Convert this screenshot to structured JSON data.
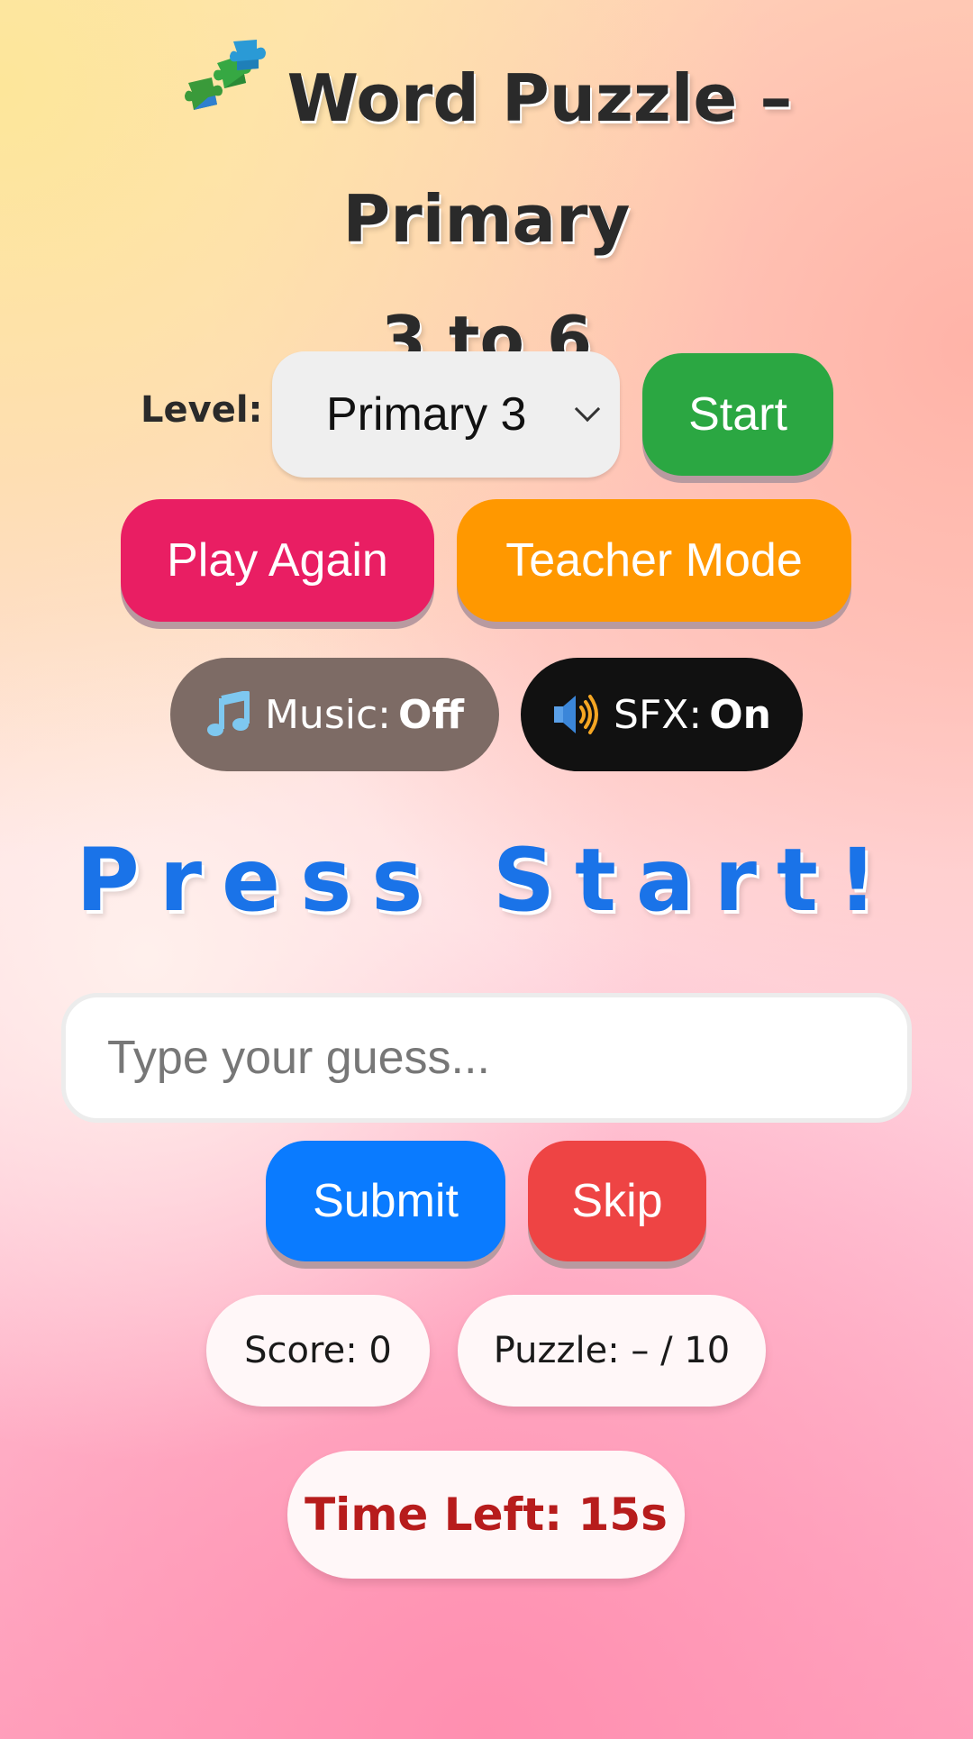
{
  "title": {
    "line1": "Word Puzzle – Primary",
    "line2": "3 to 6",
    "icon": "puzzle-pieces-icon"
  },
  "controls": {
    "level_label": "Level:",
    "level_selected": "Primary 3",
    "start_label": "Start",
    "play_again_label": "Play Again",
    "teacher_mode_label": "Teacher Mode",
    "music_label": "Music:",
    "music_state": "Off",
    "music_icon": "music-note-icon",
    "sfx_label": "SFX:",
    "sfx_state": "On",
    "sfx_icon": "speaker-icon"
  },
  "game": {
    "status_text": "Press Start!",
    "guess_placeholder": "Type your guess...",
    "guess_value": "",
    "submit_label": "Submit",
    "skip_label": "Skip"
  },
  "stats": {
    "score_text": "Score: 0",
    "puzzle_text": "Puzzle: – / 10",
    "time_text": "Time Left: 15s"
  },
  "colors": {
    "start": "#2ba742",
    "play_again": "#e91e63",
    "teacher_mode": "#ff9800",
    "music": "#7d6b65",
    "sfx": "#111111",
    "status": "#1a73e8",
    "submit": "#0a7bff",
    "skip": "#ee4444",
    "time": "#b71c1c"
  }
}
